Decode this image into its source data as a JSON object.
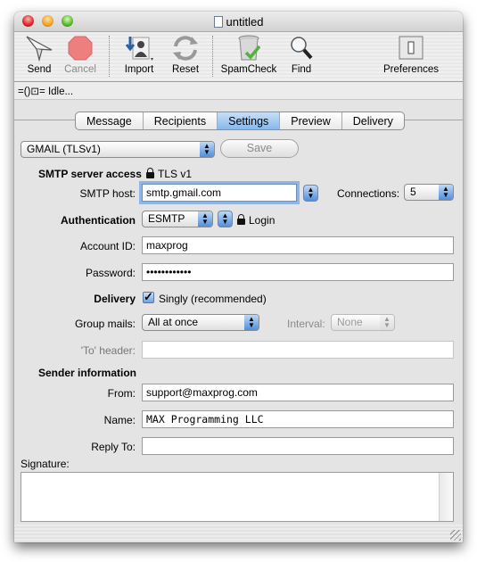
{
  "window": {
    "title": "untitled"
  },
  "toolbar": {
    "send": "Send",
    "cancel": "Cancel",
    "import": "Import",
    "reset": "Reset",
    "spamcheck": "SpamCheck",
    "find": "Find",
    "preferences": "Preferences"
  },
  "status": {
    "text": "Idle...",
    "icon": "connection-plug-icon"
  },
  "tabs": [
    {
      "label": "Message",
      "active": false
    },
    {
      "label": "Recipients",
      "active": false
    },
    {
      "label": "Settings",
      "active": true
    },
    {
      "label": "Preview",
      "active": false
    },
    {
      "label": "Delivery",
      "active": false
    }
  ],
  "settings": {
    "profile_popup": "GMAIL (TLSv1)",
    "save_label": "Save",
    "smtp_access_label": "SMTP server access",
    "smtp_access_value": "TLS v1",
    "smtp_host_label": "SMTP host:",
    "smtp_host_value": "smtp.gmail.com",
    "connections_label": "Connections:",
    "connections_value": "5",
    "authentication_label": "Authentication",
    "authentication_value": "ESMTP",
    "auth_method": "Login",
    "account_id_label": "Account ID:",
    "account_id_value": "maxprog",
    "password_label": "Password:",
    "password_value": "••••••••••••",
    "delivery_label": "Delivery",
    "delivery_checkbox_label": "Singly (recommended)",
    "delivery_checked": true,
    "group_mails_label": "Group mails:",
    "group_mails_value": "All at once",
    "interval_label": "Interval:",
    "interval_value": "None",
    "to_header_label": "'To' header:",
    "to_header_value": "",
    "sender_info_label": "Sender information",
    "from_label": "From:",
    "from_value": "support@maxprog.com",
    "name_label": "Name:",
    "name_value": "MAX Programming LLC",
    "reply_to_label": "Reply To:",
    "reply_to_value": "",
    "signature_label": "Signature:",
    "signature_value": ""
  }
}
